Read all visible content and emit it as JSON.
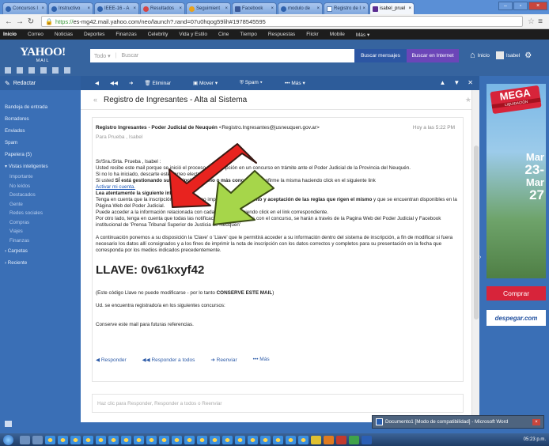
{
  "browser": {
    "tabs": [
      {
        "label": "Concursos I"
      },
      {
        "label": "Instructivo"
      },
      {
        "label": "IEEE-16 - A"
      },
      {
        "label": "Resultados"
      },
      {
        "label": "Seguimient"
      },
      {
        "label": "Facebook"
      },
      {
        "label": "modulo de"
      },
      {
        "label": "Registro de I"
      },
      {
        "label": "isabel_pruel",
        "active": true
      }
    ],
    "url_secure": "https://",
    "url_rest": "es-mg42.mail.yahoo.com/neo/launch?.rand=07u0hqog59lih#1978545595"
  },
  "yahoo_nav": [
    "Inicio",
    "Correo",
    "Noticias",
    "Deportes",
    "Finanzas",
    "Celebrity",
    "Vida y Estilo",
    "Cine",
    "Tiempo",
    "Respuestas",
    "Flickr",
    "Mobile",
    "Más ▾"
  ],
  "header": {
    "logo_main": "YAHOO!",
    "logo_sub": "MAIL",
    "search_scope": "Todo ▾",
    "search_placeholder": "Buscar",
    "search_mail_btn": "Buscar mensajes",
    "search_web_btn": "Buscar en Internet",
    "home_label": "Inicio",
    "user_name": "Isabel"
  },
  "sidebar": {
    "compose": "Redactar",
    "folders": [
      {
        "label": "Bandeja de entrada",
        "type": "head"
      },
      {
        "label": "Borradores",
        "type": "head"
      },
      {
        "label": "Enviados",
        "type": "head"
      },
      {
        "label": "Spam",
        "type": "head"
      },
      {
        "label": "Papelera (5)",
        "type": "head"
      },
      {
        "label": "▾ Vistas inteligentes",
        "type": "head"
      },
      {
        "label": "Importante",
        "type": "sub"
      },
      {
        "label": "No leídos",
        "type": "sub"
      },
      {
        "label": "Destacados",
        "type": "sub"
      },
      {
        "label": "Gente",
        "type": "sub"
      },
      {
        "label": "Redes sociales",
        "type": "sub"
      },
      {
        "label": "Compras",
        "type": "sub"
      },
      {
        "label": "Viajes",
        "type": "sub"
      },
      {
        "label": "Finanzas",
        "type": "sub"
      },
      {
        "label": "› Carpetas",
        "type": "head"
      },
      {
        "label": "› Reciente",
        "type": "head"
      }
    ]
  },
  "toolbar": {
    "delete": "Eliminar",
    "move": "Mover ▾",
    "spam": "Spam ▾",
    "more": "••• Más ▾"
  },
  "message": {
    "subject": "Registro de Ingresantes - Alta al Sistema",
    "from_name": "Registro Ingresantes - Poder Judicial de Neuquén",
    "from_email": "<Registro.Ingresantes@jusneuquen.gov.ar>",
    "time": "Hoy a las 5:22 PM",
    "to": "Para Prueba , Isabel",
    "greeting": "Sr/Sra./Srta. Prueba , Isabel :",
    "p1": "Usted recibe este mail porque se inició el proceso de inscripción en un concurso en trámite ante el Poder Judicial de la Provincia del Neuquén.",
    "p2": "Si no lo ha iniciado, descarte este correo electrónico.",
    "p3_a": "Si usted ",
    "p3_b": "SÍ está gestionando su inscripción en uno o más concursos",
    "p3_c": ", confirme la misma haciendo click en el siguiente link",
    "link": "Activar mi cuenta.",
    "warn_title": "Lea atentamente la siguiente información:",
    "p4_a": "Tenga en cuenta que la inscripción en el concurso implica el ",
    "p4_b": "conocimiento y aceptación de las reglas que rigen el mismo",
    "p4_c": " y que se encuentran disponibles en la Página Web del Poder Judicial.",
    "p5": "Puede acceder a la información relacionada con cada concurso haciendo click en el link correspondiente.",
    "p6": "Por otro lado, tenga en cuenta que todas las notificaciones relacionadas con el concurso, se harán a través de la Pagina Web del Poder Judicial y Facebook institucional de 'Prensa Tribunal Superior de Justicia de Neuquen'",
    "p7": "A continuación ponemos a su disposición la 'Clave' o 'Llave' que le permitirá acceder a su información dentro del sistema de inscripción, a fin de modificar si fuera necesario los datos allí consignados y a los fines de imprimir la nota de inscripción con los datos correctos y completos para su presentación en la fecha que corresponda por los medios indicados precedentemente.",
    "llave": "LLAVE: 0v61kxyf42",
    "p8_a": "(Este código Llave no puede modificarse - por lo tanto ",
    "p8_b": "CONSERVE ESTE MAIL",
    "p8_c": ")",
    "p9": "Ud. se encuentra registrado/a en los siguientes concursos:",
    "p10": "Conserve este mail para futuras referencias.",
    "act_reply": "Responder",
    "act_reply_all": "Responder a todos",
    "act_forward": "Reenviar",
    "act_more": "••• Más",
    "reply_hint": "Haz clic para Responder, Responder a todos o Reenviar"
  },
  "ad": {
    "badge": "MEGA",
    "badge_sub": "LIQUIDACIÓN",
    "line1": "Mar",
    "line2": "23-",
    "line3": "Mar",
    "line4": "27",
    "cta": "Comprar",
    "brand": "despegar.com"
  },
  "taskbar": {
    "popup": "Documento1 [Modo de compatibilidad] - Microsoft Word",
    "clock": "05:23 p.m."
  }
}
